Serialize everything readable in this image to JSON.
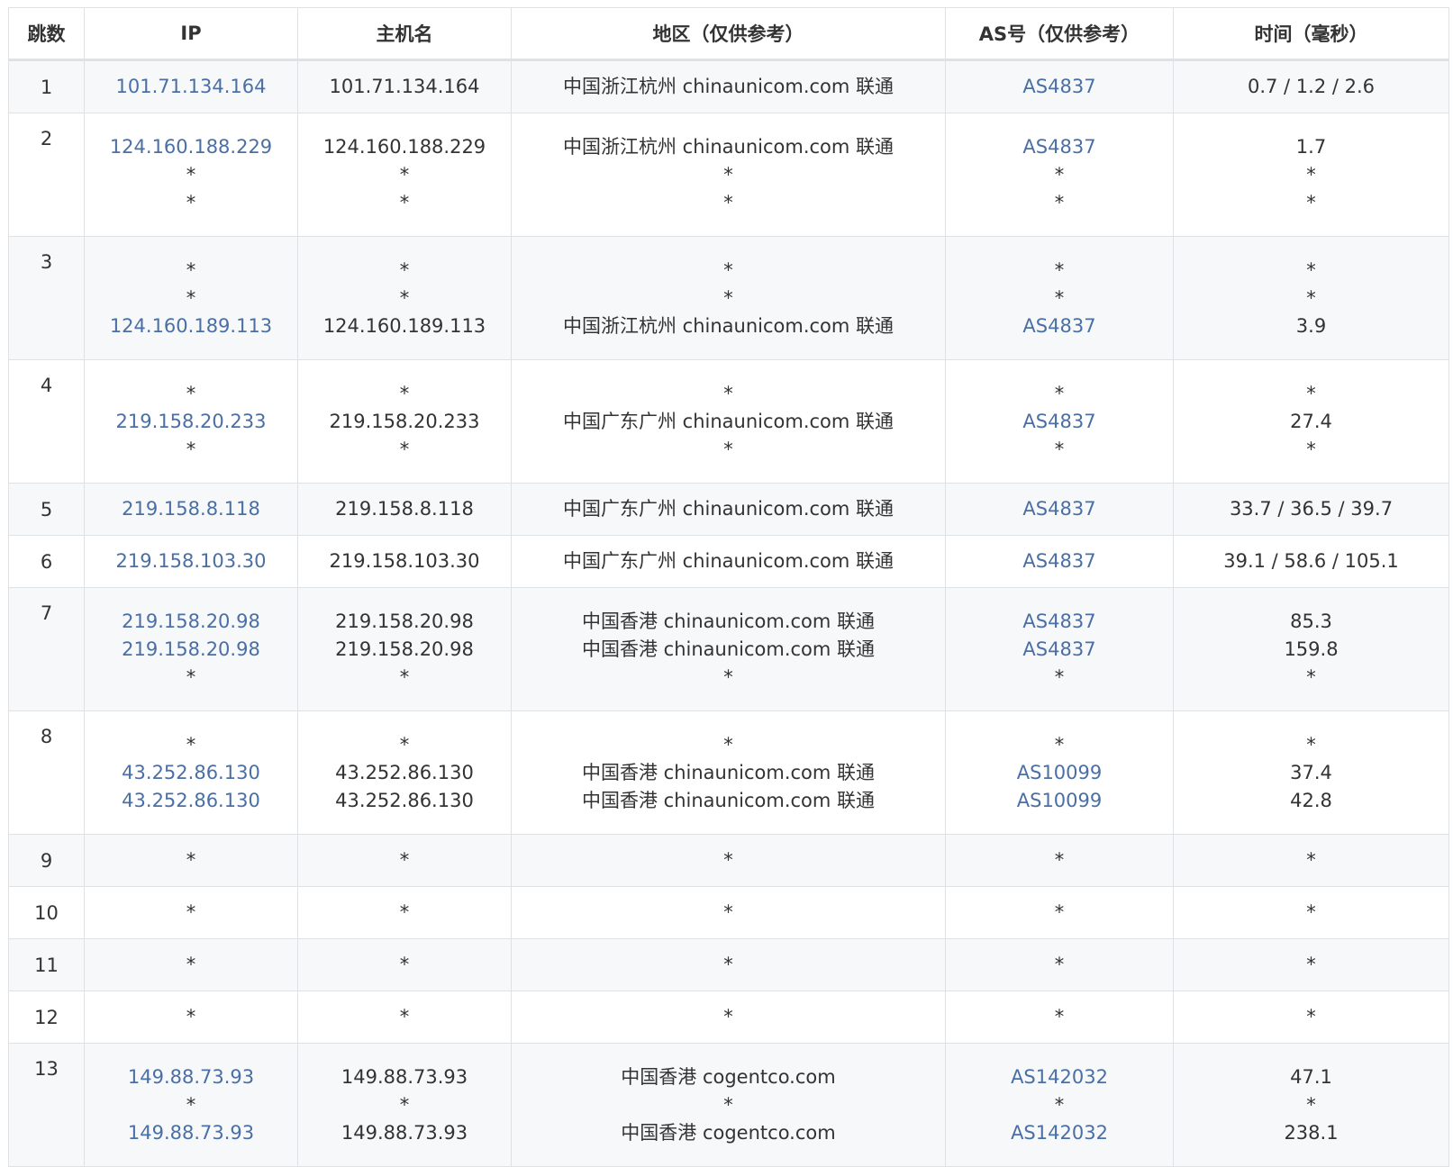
{
  "headers": [
    "跳数",
    "IP",
    "主机名",
    "地区（仅供参考）",
    "AS号（仅供参考）",
    "时间（毫秒）"
  ],
  "hops": [
    {
      "hop": "1",
      "probes": [
        {
          "ip": "101.71.134.164",
          "host": "101.71.134.164",
          "region": "中国浙江杭州 chinaunicom.com 联通",
          "as": "AS4837",
          "time": "0.7 / 1.2 / 2.6"
        }
      ]
    },
    {
      "hop": "2",
      "probes": [
        {
          "ip": "124.160.188.229",
          "host": "124.160.188.229",
          "region": "中国浙江杭州 chinaunicom.com 联通",
          "as": "AS4837",
          "time": "1.7"
        },
        {
          "ip": "*",
          "host": "*",
          "region": "*",
          "as": "*",
          "time": "*"
        },
        {
          "ip": "*",
          "host": "*",
          "region": "*",
          "as": "*",
          "time": "*"
        }
      ]
    },
    {
      "hop": "3",
      "probes": [
        {
          "ip": "*",
          "host": "*",
          "region": "*",
          "as": "*",
          "time": "*"
        },
        {
          "ip": "*",
          "host": "*",
          "region": "*",
          "as": "*",
          "time": "*"
        },
        {
          "ip": "124.160.189.113",
          "host": "124.160.189.113",
          "region": "中国浙江杭州 chinaunicom.com 联通",
          "as": "AS4837",
          "time": "3.9"
        }
      ]
    },
    {
      "hop": "4",
      "probes": [
        {
          "ip": "*",
          "host": "*",
          "region": "*",
          "as": "*",
          "time": "*"
        },
        {
          "ip": "219.158.20.233",
          "host": "219.158.20.233",
          "region": "中国广东广州 chinaunicom.com 联通",
          "as": "AS4837",
          "time": "27.4"
        },
        {
          "ip": "*",
          "host": "*",
          "region": "*",
          "as": "*",
          "time": "*"
        }
      ]
    },
    {
      "hop": "5",
      "probes": [
        {
          "ip": "219.158.8.118",
          "host": "219.158.8.118",
          "region": "中国广东广州 chinaunicom.com 联通",
          "as": "AS4837",
          "time": "33.7 / 36.5 / 39.7"
        }
      ]
    },
    {
      "hop": "6",
      "probes": [
        {
          "ip": "219.158.103.30",
          "host": "219.158.103.30",
          "region": "中国广东广州 chinaunicom.com 联通",
          "as": "AS4837",
          "time": "39.1 / 58.6 / 105.1"
        }
      ]
    },
    {
      "hop": "7",
      "probes": [
        {
          "ip": "219.158.20.98",
          "host": "219.158.20.98",
          "region": "中国香港 chinaunicom.com 联通",
          "as": "AS4837",
          "time": "85.3"
        },
        {
          "ip": "219.158.20.98",
          "host": "219.158.20.98",
          "region": "中国香港 chinaunicom.com 联通",
          "as": "AS4837",
          "time": "159.8"
        },
        {
          "ip": "*",
          "host": "*",
          "region": "*",
          "as": "*",
          "time": "*"
        }
      ]
    },
    {
      "hop": "8",
      "probes": [
        {
          "ip": "*",
          "host": "*",
          "region": "*",
          "as": "*",
          "time": "*"
        },
        {
          "ip": "43.252.86.130",
          "host": "43.252.86.130",
          "region": "中国香港 chinaunicom.com 联通",
          "as": "AS10099",
          "time": "37.4"
        },
        {
          "ip": "43.252.86.130",
          "host": "43.252.86.130",
          "region": "中国香港 chinaunicom.com 联通",
          "as": "AS10099",
          "time": "42.8"
        }
      ]
    },
    {
      "hop": "9",
      "probes": [
        {
          "ip": "*",
          "host": "*",
          "region": "*",
          "as": "*",
          "time": "*"
        }
      ]
    },
    {
      "hop": "10",
      "probes": [
        {
          "ip": "*",
          "host": "*",
          "region": "*",
          "as": "*",
          "time": "*"
        }
      ]
    },
    {
      "hop": "11",
      "probes": [
        {
          "ip": "*",
          "host": "*",
          "region": "*",
          "as": "*",
          "time": "*"
        }
      ]
    },
    {
      "hop": "12",
      "probes": [
        {
          "ip": "*",
          "host": "*",
          "region": "*",
          "as": "*",
          "time": "*"
        }
      ]
    },
    {
      "hop": "13",
      "probes": [
        {
          "ip": "149.88.73.93",
          "host": "149.88.73.93",
          "region": "中国香港 cogentco.com",
          "as": "AS142032",
          "time": "47.1"
        },
        {
          "ip": "*",
          "host": "*",
          "region": "*",
          "as": "*",
          "time": "*"
        },
        {
          "ip": "149.88.73.93",
          "host": "149.88.73.93",
          "region": "中国香港 cogentco.com",
          "as": "AS142032",
          "time": "238.1"
        }
      ]
    }
  ],
  "colors": {
    "link": "#4a6fa5",
    "text": "#333333",
    "border": "#dfe2e5",
    "stripe": "#f6f8fa"
  }
}
